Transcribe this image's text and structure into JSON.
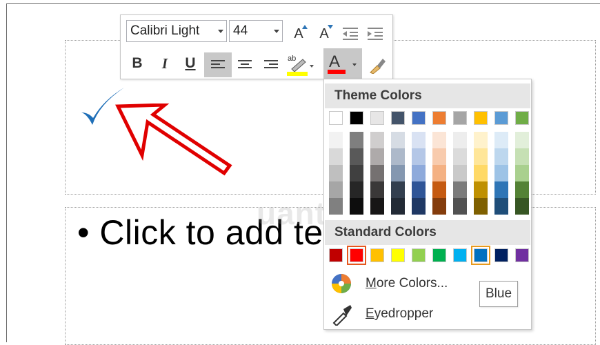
{
  "slide": {
    "bullet_text": "Click to add te",
    "bullet_char": "•"
  },
  "mini_toolbar": {
    "font_name": "Calibri Light",
    "font_size": "44",
    "bold_label": "B",
    "italic_label": "I",
    "underline_label": "U",
    "grow_label": "A",
    "shrink_label": "A",
    "highlight_label": "ab",
    "font_color_label": "A"
  },
  "color_panel": {
    "theme_header": "Theme Colors",
    "standard_header": "Standard Colors",
    "more_colors_label": "More Colors...",
    "eyedropper_label": "Eyedropper",
    "theme_top": [
      "#ffffff",
      "#000000",
      "#e7e6e6",
      "#44546a",
      "#4472c4",
      "#ed7d31",
      "#a5a5a5",
      "#ffc000",
      "#5b9bd5",
      "#70ad47"
    ],
    "theme_shades": [
      [
        "#f2f2f2",
        "#7f7f7f",
        "#d0cece",
        "#d6dce4",
        "#d9e2f3",
        "#fbe5d6",
        "#ededed",
        "#fff2cc",
        "#ddebf7",
        "#e2efda"
      ],
      [
        "#d9d9d9",
        "#595959",
        "#aeaaaa",
        "#adb9ca",
        "#b4c7e7",
        "#f8cbad",
        "#dbdbdb",
        "#ffe699",
        "#bdd7ee",
        "#c6e0b4"
      ],
      [
        "#bfbfbf",
        "#404040",
        "#757171",
        "#8497b0",
        "#8eaadb",
        "#f4b183",
        "#c9c9c9",
        "#ffd966",
        "#9dc3e6",
        "#a9d08e"
      ],
      [
        "#a6a6a6",
        "#262626",
        "#3a3838",
        "#333f4f",
        "#2f5597",
        "#c55a11",
        "#7b7b7b",
        "#bf9000",
        "#2e75b6",
        "#548235"
      ],
      [
        "#808080",
        "#0d0d0d",
        "#171616",
        "#222a35",
        "#1f3864",
        "#843c0c",
        "#525252",
        "#7f6000",
        "#1f4e79",
        "#375623"
      ]
    ],
    "standard": [
      "#c00000",
      "#ff0000",
      "#ffc000",
      "#ffff00",
      "#92d050",
      "#00b050",
      "#00b0f0",
      "#0070c0",
      "#002060",
      "#7030a0"
    ],
    "tooltip": "Blue"
  },
  "watermark": "uantrimang",
  "colors": {
    "checkmark": "#1f6fb8",
    "arrow": "#e00000",
    "font_color_bar": "#ff0000",
    "highlight_bar": "#ffff00"
  }
}
